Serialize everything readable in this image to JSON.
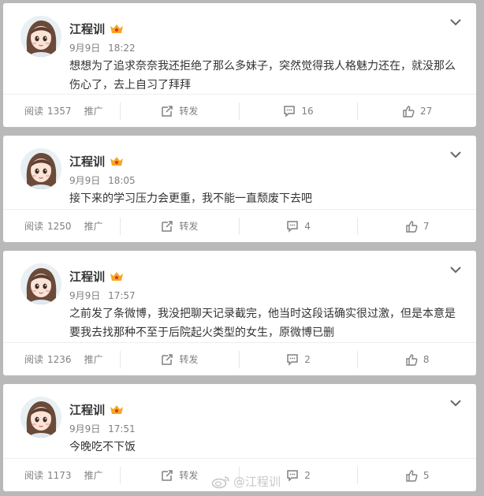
{
  "posts": [
    {
      "username": "江程训",
      "date": "9月9日",
      "time": "18:22",
      "text": "想想为了追求奈奈我还拒绝了那么多妹子，突然觉得我人格魅力还在，就没那么伤心了，去上自习了拜拜",
      "read_label": "阅读",
      "read_count": "1357",
      "promote_label": "推广",
      "repost_label": "转发",
      "comment_count": "16",
      "like_count": "27"
    },
    {
      "username": "江程训",
      "date": "9月9日",
      "time": "18:05",
      "text": "接下来的学习压力会更重，我不能一直颓废下去吧",
      "read_label": "阅读",
      "read_count": "1250",
      "promote_label": "推广",
      "repost_label": "转发",
      "comment_count": "4",
      "like_count": "7"
    },
    {
      "username": "江程训",
      "date": "9月9日",
      "time": "17:57",
      "text": "之前发了条微博，我没把聊天记录截完，他当时这段话确实很过激，但是本意是要我去找那种不至于后院起火类型的女生，原微博已删",
      "read_label": "阅读",
      "read_count": "1236",
      "promote_label": "推广",
      "repost_label": "转发",
      "comment_count": "2",
      "like_count": "8"
    },
    {
      "username": "江程训",
      "date": "9月9日",
      "time": "17:51",
      "text": "今晚吃不下饭",
      "read_label": "阅读",
      "read_count": "1173",
      "promote_label": "推广",
      "repost_label": "转发",
      "comment_count": "2",
      "like_count": "5"
    }
  ],
  "watermark": "@江程训",
  "icons": {
    "menu": "chevron-down-icon",
    "repost": "repost-icon",
    "comment": "comment-icon",
    "like": "thumbs-up-icon",
    "badge": "vip-crown-icon"
  },
  "colors": {
    "background": "#b9b9b9",
    "card": "#ffffff",
    "text": "#333333",
    "muted": "#808080",
    "badge": "#f5a623"
  }
}
